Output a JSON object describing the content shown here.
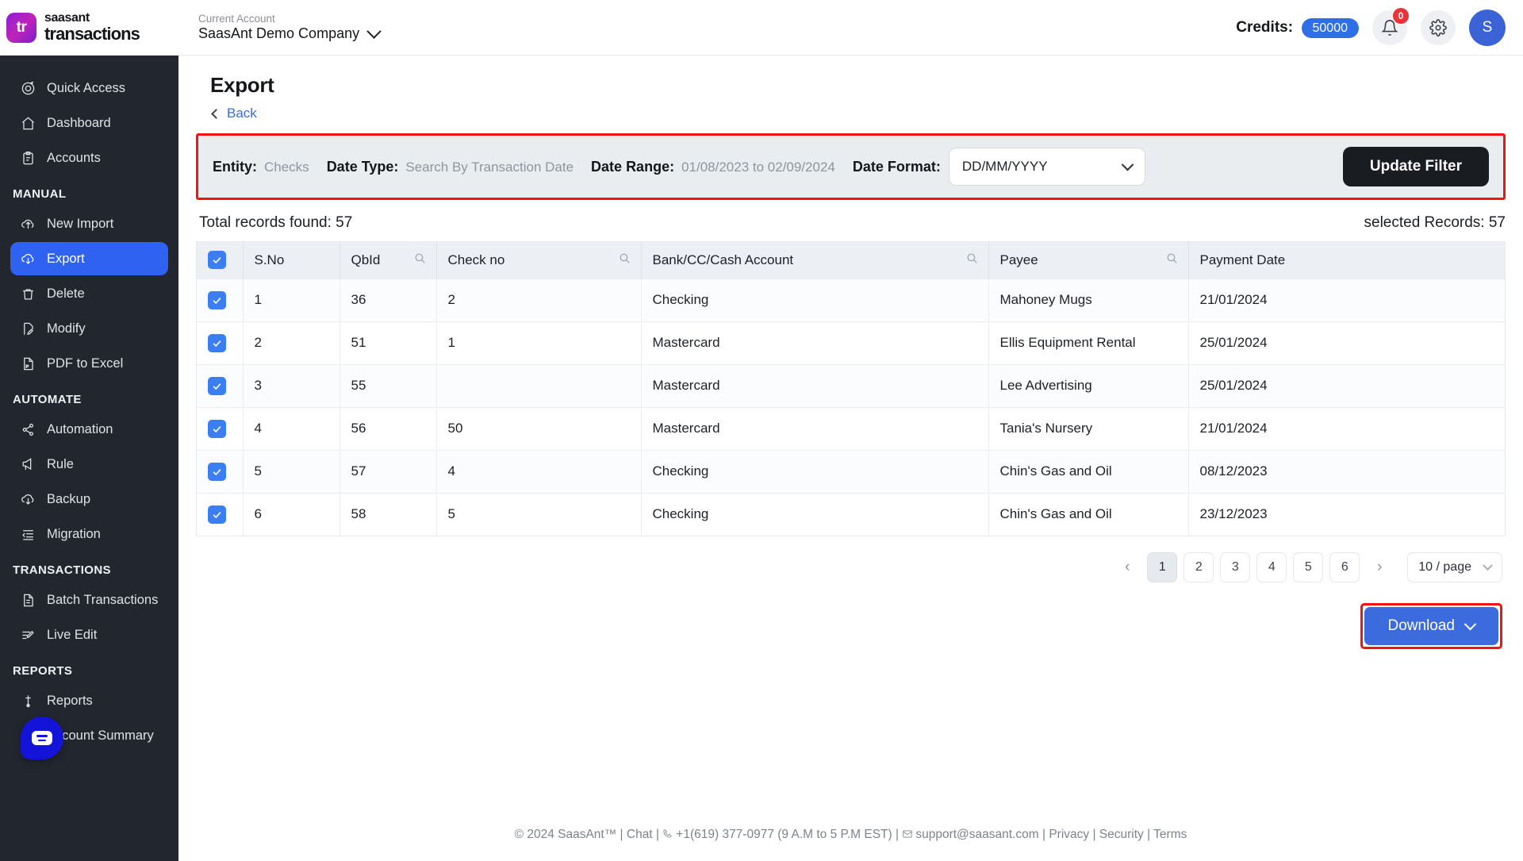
{
  "header": {
    "logo_mark": "tr",
    "brand_top": "saasant",
    "brand_bottom": "transactions",
    "account_label": "Current Account",
    "account_name": "SaasAnt Demo Company",
    "credits_label": "Credits:",
    "credits_value": "50000",
    "notification_count": "0",
    "avatar_initial": "S",
    "accent_blue": "#2f6fe4",
    "badge_red": "#e8333a"
  },
  "sidebar": {
    "items": [
      {
        "label": "Quick Access",
        "icon": "target-icon",
        "active": false
      },
      {
        "label": "Dashboard",
        "icon": "home-icon",
        "active": false
      },
      {
        "label": "Accounts",
        "icon": "clipboard-icon",
        "active": false
      }
    ],
    "section_manual": "MANUAL",
    "manual_items": [
      {
        "label": "New Import",
        "icon": "upload-cloud-icon",
        "active": false
      },
      {
        "label": "Export",
        "icon": "download-cloud-icon",
        "active": true
      },
      {
        "label": "Delete",
        "icon": "trash-icon",
        "active": false
      },
      {
        "label": "Modify",
        "icon": "edit-file-icon",
        "active": false
      },
      {
        "label": "PDF to Excel",
        "icon": "pdf-file-icon",
        "active": false
      }
    ],
    "section_automate": "AUTOMATE",
    "automate_items": [
      {
        "label": "Automation",
        "icon": "share-nodes-icon",
        "active": false
      },
      {
        "label": "Rule",
        "icon": "megaphone-icon",
        "active": false
      },
      {
        "label": "Backup",
        "icon": "download-cloud-icon",
        "active": false
      },
      {
        "label": "Migration",
        "icon": "list-indent-icon",
        "active": false
      }
    ],
    "section_transactions": "TRANSACTIONS",
    "transaction_items": [
      {
        "label": "Batch Transactions",
        "icon": "document-icon",
        "active": false
      },
      {
        "label": "Live Edit",
        "icon": "live-edit-icon",
        "active": false
      }
    ],
    "section_reports": "REPORTS",
    "report_items": [
      {
        "label": "Reports",
        "icon": "report-icon",
        "active": false
      },
      {
        "label": "Account Summary",
        "icon": "clipboard-icon",
        "active": false
      }
    ],
    "chat_widget": "chat-icon",
    "active_color": "#2f62f0"
  },
  "main": {
    "page_title": "Export",
    "back_label": "Back",
    "filter": {
      "entity_label": "Entity:",
      "entity_value": "Checks",
      "date_type_label": "Date Type:",
      "date_type_value": "Search By Transaction Date",
      "date_range_label": "Date Range:",
      "date_range_value": "01/08/2023 to 02/09/2024",
      "date_format_label": "Date Format:",
      "date_format_value": "DD/MM/YYYY",
      "update_button": "Update Filter",
      "highlight_color": "#f41212"
    },
    "total_records": "Total records found: 57",
    "selected_records": "selected Records: 57",
    "table": {
      "columns": [
        {
          "key": "sno",
          "label": "S.No",
          "searchable": false
        },
        {
          "key": "qbid",
          "label": "QbId",
          "searchable": true
        },
        {
          "key": "checkno",
          "label": "Check no",
          "searchable": true
        },
        {
          "key": "bank",
          "label": "Bank/CC/Cash Account",
          "searchable": true
        },
        {
          "key": "payee",
          "label": "Payee",
          "searchable": true
        },
        {
          "key": "paymentdate",
          "label": "Payment Date",
          "searchable": false
        }
      ],
      "rows": [
        {
          "checked": true,
          "sno": "1",
          "qbid": "36",
          "checkno": "2",
          "bank": "Checking",
          "payee": "Mahoney Mugs",
          "paymentdate": "21/01/2024"
        },
        {
          "checked": true,
          "sno": "2",
          "qbid": "51",
          "checkno": "1",
          "bank": "Mastercard",
          "payee": "Ellis Equipment Rental",
          "paymentdate": "25/01/2024"
        },
        {
          "checked": true,
          "sno": "3",
          "qbid": "55",
          "checkno": "",
          "bank": "Mastercard",
          "payee": "Lee Advertising",
          "paymentdate": "25/01/2024"
        },
        {
          "checked": true,
          "sno": "4",
          "qbid": "56",
          "checkno": "50",
          "bank": "Mastercard",
          "payee": "Tania's Nursery",
          "paymentdate": "21/01/2024"
        },
        {
          "checked": true,
          "sno": "5",
          "qbid": "57",
          "checkno": "4",
          "bank": "Checking",
          "payee": "Chin's Gas and Oil",
          "paymentdate": "08/12/2023"
        },
        {
          "checked": true,
          "sno": "6",
          "qbid": "58",
          "checkno": "5",
          "bank": "Checking",
          "payee": "Chin's Gas and Oil",
          "paymentdate": "23/12/2023"
        }
      ]
    },
    "pagination": {
      "prev": "‹",
      "next": "›",
      "pages": [
        "1",
        "2",
        "3",
        "4",
        "5",
        "6"
      ],
      "current_page": "1",
      "page_size": "10 / page"
    },
    "download_button": "Download"
  },
  "footer": {
    "copyright": "© 2024 SaasAnt™",
    "sep": "|",
    "chat": "Chat",
    "phone": "+1(619) 377-0977 (9 A.M to 5 P.M EST)",
    "email": "support@saasant.com",
    "privacy": "Privacy",
    "security": "Security",
    "terms": "Terms"
  }
}
